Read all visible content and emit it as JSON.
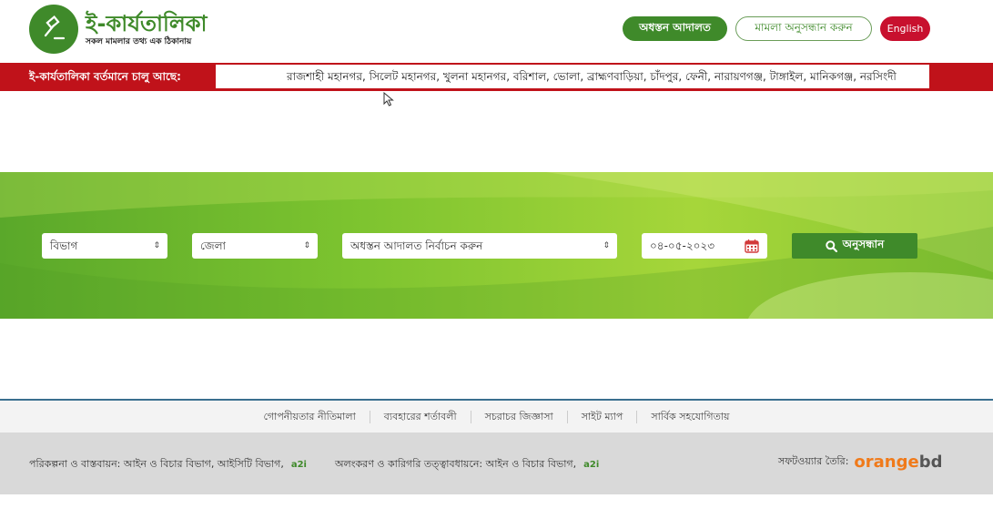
{
  "header": {
    "logo_title": "ই-কার্যতালিকা",
    "logo_subtitle": "সকল মামলার তথ্য এক ঠিকানায়",
    "btn_lower_court": "অধস্তন আদালত",
    "btn_case_search": "মামলা অনুসন্ধান করুন",
    "btn_english": "English"
  },
  "ticker": {
    "label": "ই-কার্যতালিকা বর্তমানে চালু আছে:",
    "text": "রাজশাহী মহানগর, সিলেট মহানগর, খুলনা মহানগর, বরিশাল, ভোলা, ব্রাহ্মণবাড়িয়া, চাঁদপুর, ফেনী, নারায়ণগঞ্জ, টাঙ্গাইল, মানিকগঞ্জ, নরসিংদী"
  },
  "search": {
    "division": "বিভাগ",
    "district": "জেলা",
    "court": "অধস্তন আদালত নির্বাচন করুন",
    "date": "০৪-০৫-২০২৩",
    "button": "অনুসন্ধান"
  },
  "footer": {
    "links": [
      "গোপনীয়তার নীতিমালা",
      "ব্যবহারের শর্তাবলী",
      "সচরাচর জিজ্ঞাসা",
      "সাইট ম্যাপ",
      "সার্বিক সহযোগিতায়"
    ],
    "planning": "পরিকল্পনা ও বাস্তবায়ন: আইন ও বিচার বিভাগ, আইসিটি বিভাগ,",
    "decoration": "অলংকরণ ও কারিগরি তত্ত্বাবধায়নে: আইন ও বিচার বিভাগ,",
    "a2i": "a2i",
    "software_by": "সফটওয়্যার তৈরি:",
    "brand_orange": "orange",
    "brand_bd": "bd"
  },
  "colors": {
    "brand_green": "#3f8a2a",
    "ticker_red": "#c0121a",
    "english_red": "#c8102e",
    "orange": "#f07a1a"
  },
  "icons": [
    "gavel-icon",
    "calendar-icon",
    "search-icon",
    "cursor-icon"
  ]
}
